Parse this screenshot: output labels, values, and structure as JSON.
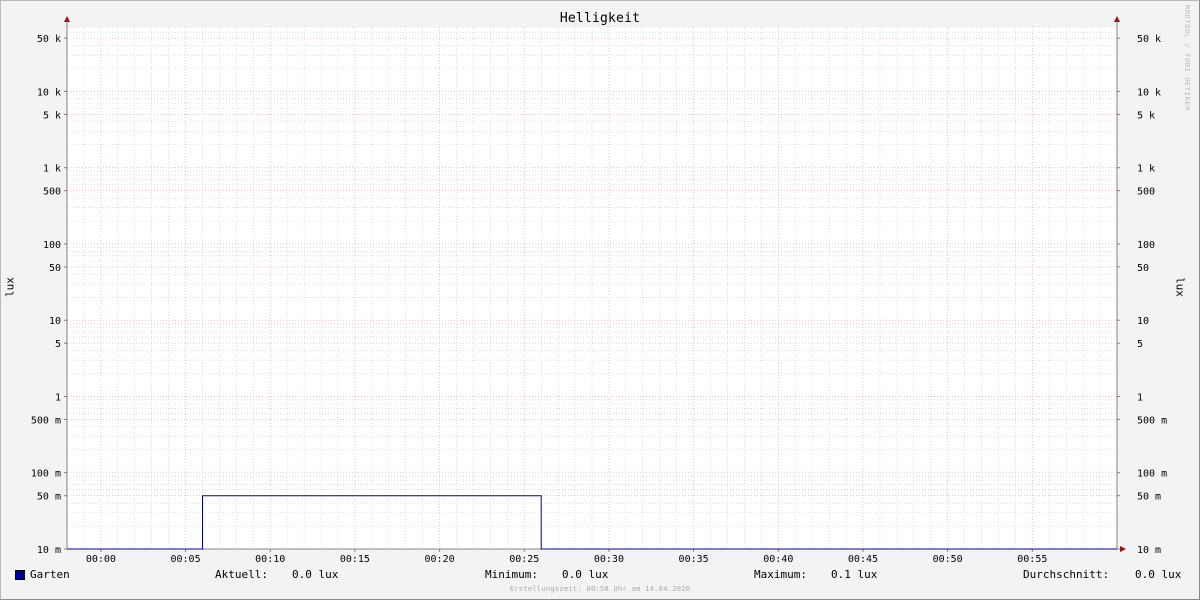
{
  "chart_data": {
    "type": "line",
    "title": "Helligkeit",
    "ylabel": "lux",
    "yscale": "log",
    "ylim": [
      0.01,
      70000
    ],
    "xlim": [
      "23:58",
      "01:00"
    ],
    "x_ticks": [
      "00:00",
      "00:05",
      "00:10",
      "00:15",
      "00:20",
      "00:25",
      "00:30",
      "00:35",
      "00:40",
      "00:45",
      "00:50",
      "00:55"
    ],
    "y_ticks": [
      {
        "value": 0.01,
        "label": "10 m"
      },
      {
        "value": 0.05,
        "label": "50 m"
      },
      {
        "value": 0.1,
        "label": "100 m"
      },
      {
        "value": 0.5,
        "label": "500 m"
      },
      {
        "value": 1,
        "label": "1"
      },
      {
        "value": 5,
        "label": "5"
      },
      {
        "value": 10,
        "label": "10"
      },
      {
        "value": 50,
        "label": "50"
      },
      {
        "value": 100,
        "label": "100"
      },
      {
        "value": 500,
        "label": "500"
      },
      {
        "value": 1000,
        "label": "1 k"
      },
      {
        "value": 5000,
        "label": "5 k"
      },
      {
        "value": 10000,
        "label": "10 k"
      },
      {
        "value": 50000,
        "label": "50 k"
      }
    ],
    "grid": true,
    "series": [
      {
        "name": "Garten",
        "color": "#0000a0",
        "x": [
          "23:58",
          "00:06",
          "00:06",
          "00:26",
          "00:26",
          "01:00"
        ],
        "y": [
          0.01,
          0.01,
          0.05,
          0.05,
          0.01,
          0.01
        ]
      }
    ],
    "legend": {
      "series_label": "Garten",
      "current_label": "Aktuell:",
      "current_value": "0.0 lux",
      "min_label": "Minimum:",
      "min_value": "0.0 lux",
      "max_label": "Maximum:",
      "max_value": "0.1 lux",
      "avg_label": "Durchschnitt:",
      "avg_value": "0.0 lux"
    }
  },
  "watermark": "RRDTOOL / TOBI OETIKER",
  "footer": "Erstellungszeit: 00:58 Uhr am 14.04.2026",
  "colors": {
    "major_grid": "#e0a0a0",
    "minor_grid": "#c8c8c8",
    "axis": "#808080",
    "arrow": "#a01010",
    "line": "#0000a0"
  }
}
